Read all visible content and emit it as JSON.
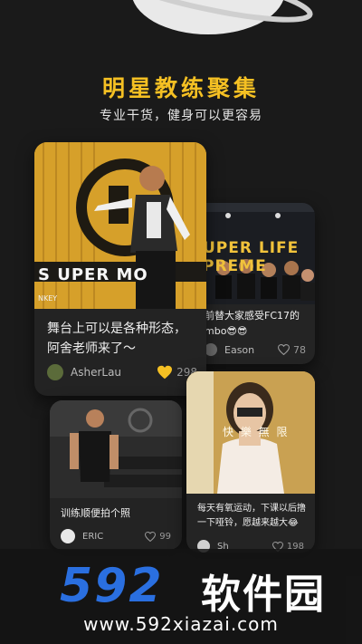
{
  "header": {
    "headline": "明星教练聚集",
    "subline": "专业干货，健身可以更容易"
  },
  "cards": {
    "main": {
      "photo_text": "S UPER MO",
      "photo_sub": "NKEY",
      "title": "舞台上可以是各种形态，阿舍老师来了～",
      "author": "AsherLau",
      "likes": "298"
    },
    "back_right": {
      "photo_text": "UPER LIFE",
      "photo_text2": "PREME",
      "title": "前替大家感受FC17的mbo😎😎",
      "author": "Eason",
      "likes": "78"
    },
    "bottom_left": {
      "title": "训练顺便拍个照",
      "author": "ERIC",
      "likes": "99"
    },
    "bottom_right": {
      "photo_text": "快 樂 無 限",
      "title": "每天有氧运动，下课以后撸一下哑铃，愿越来越大😂",
      "author": "Sh",
      "likes": "198"
    }
  },
  "watermark": {
    "logo": "592",
    "name": "软件园",
    "url": "www.592xiazai.com"
  },
  "colors": {
    "background": "#1a1a1a",
    "accent": "#f5c023",
    "card": "#222222",
    "watermark_blue": "#2a6fe0"
  }
}
